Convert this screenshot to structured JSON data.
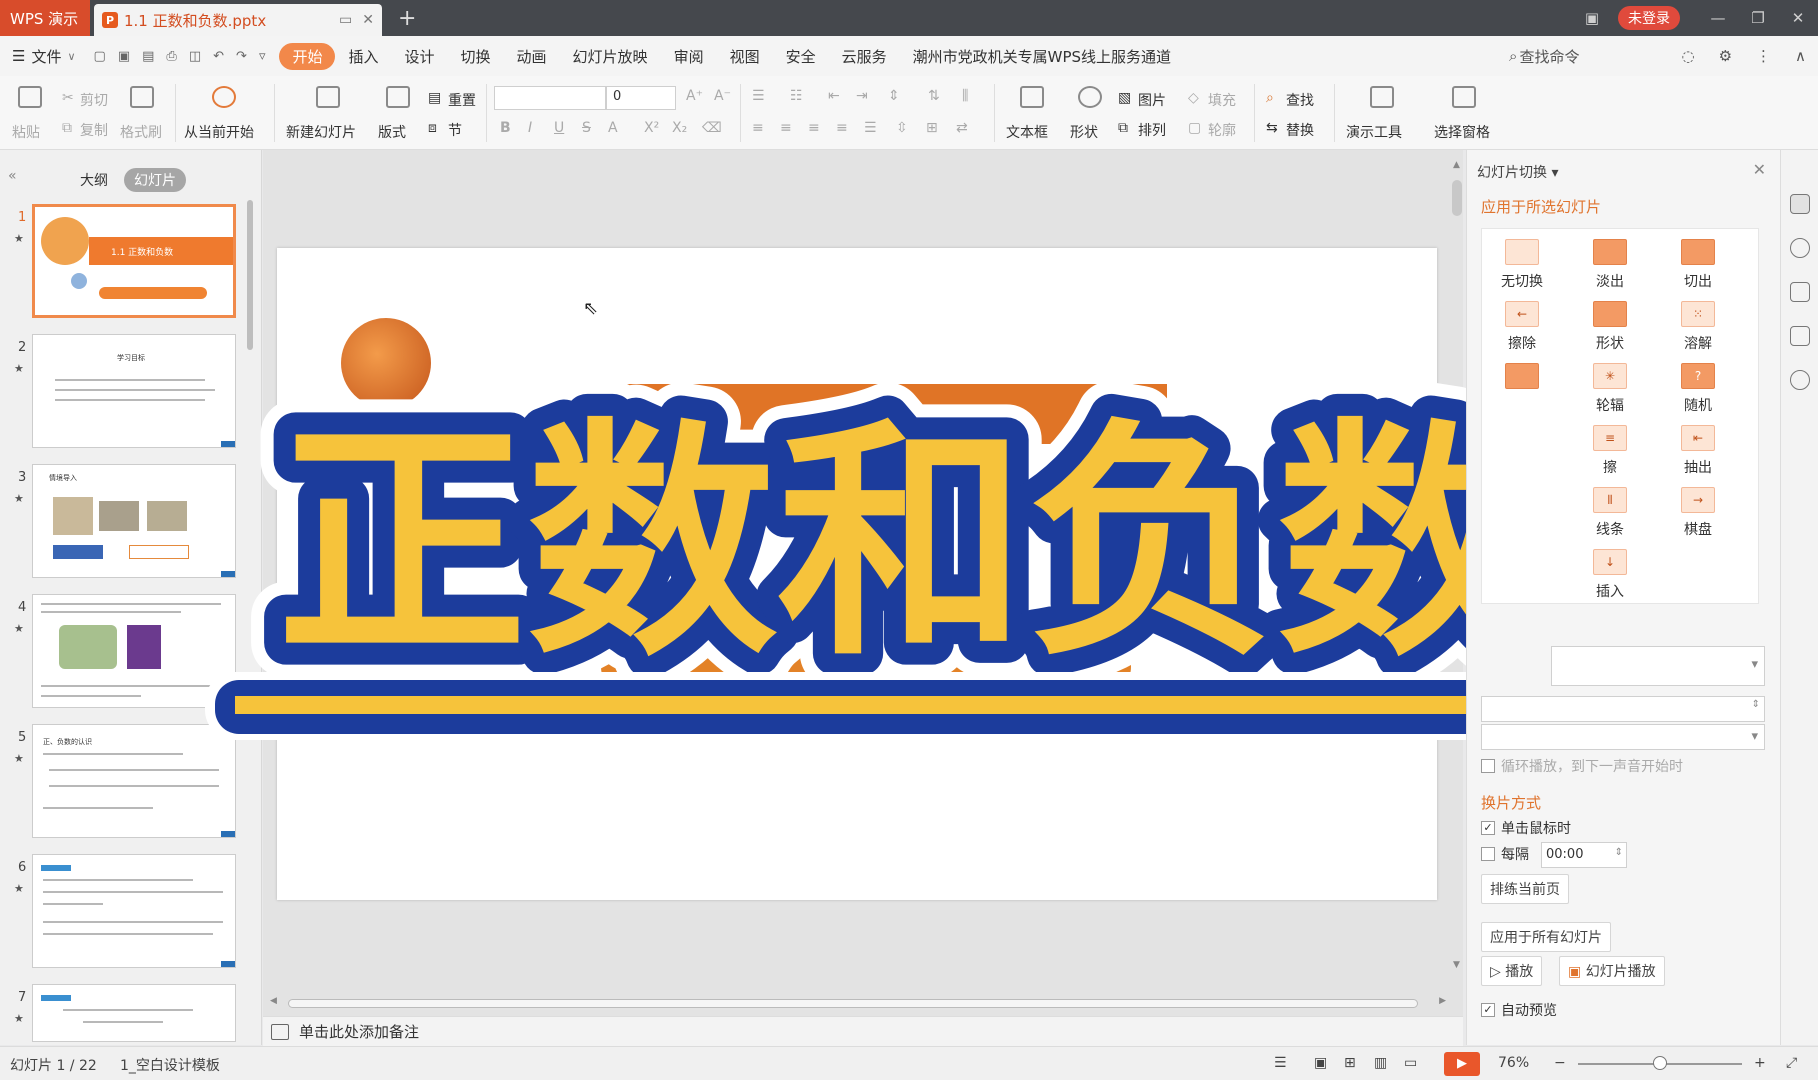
{
  "titlebar": {
    "app_name": "WPS 演示",
    "doc_tab": "1.1 正数和负数.pptx",
    "doc_icon": "P",
    "new_tab": "+",
    "login": "未登录",
    "controls": [
      "minimize-icon",
      "restore-icon",
      "close-icon"
    ]
  },
  "menubar": {
    "file": "文件",
    "items": [
      "开始",
      "插入",
      "设计",
      "切换",
      "动画",
      "幻灯片放映",
      "审阅",
      "视图",
      "安全",
      "云服务",
      "潮州市党政机关专属WPS线上服务通道"
    ],
    "active": "开始",
    "search": "查找命令"
  },
  "ribbon": {
    "paste": "粘贴",
    "cut": "剪切",
    "copy": "复制",
    "format_painter": "格式刷",
    "from_current": "从当前开始",
    "new_slide": "新建幻灯片",
    "layout": "版式",
    "reset": "重置",
    "section": "节",
    "font_size": "0",
    "font_name": "",
    "text_box": "文本框",
    "shape": "形状",
    "picture": "图片",
    "arrange": "排列",
    "fill": "填充",
    "outline": "轮廓",
    "find": "查找",
    "replace": "替换",
    "present_tools": "演示工具",
    "select_pane": "选择窗格"
  },
  "left_panel": {
    "tabs": [
      "大纲",
      "幻灯片"
    ],
    "active_tab": "幻灯片",
    "slides": [
      {
        "num": "1",
        "title": "1.1 正数和负数"
      },
      {
        "num": "2",
        "title": "学习目标"
      },
      {
        "num": "3",
        "title": "情境导入"
      },
      {
        "num": "4",
        "title": ""
      },
      {
        "num": "5",
        "title": "正、负数的认识"
      },
      {
        "num": "6",
        "title": ""
      },
      {
        "num": "7",
        "title": ""
      }
    ]
  },
  "slide_title_overlay": "正数和负数",
  "notes": "单击此处添加备注",
  "right_panel": {
    "title": "幻灯片切换",
    "apply_selected": "应用于所选幻灯片",
    "transitions": [
      "无切换",
      "淡出",
      "切出",
      "擦除",
      "形状",
      "溶解",
      "",
      "轮辐",
      "随机",
      "",
      "",
      "抽出",
      "",
      "",
      "棋盘",
      "",
      "插入",
      ""
    ],
    "visible_partials": [
      "擦",
      "线条"
    ],
    "loop_sound": "循环播放，到下一声音开始时",
    "advance_title": "换片方式",
    "on_click": "单击鼠标时",
    "every": "每隔",
    "every_time": "00:00",
    "rehearse": "排练当前页",
    "apply_all": "应用于所有幻灯片",
    "play": "播放",
    "slideshow": "幻灯片播放",
    "auto_preview": "自动预览"
  },
  "statusbar": {
    "slide_info": "幻灯片 1 / 22",
    "template": "1_空白设计模板",
    "zoom": "76%",
    "zoom_level": 0.5
  },
  "colors": {
    "accent": "#f2884a",
    "overlay_text": "#f6c33b",
    "overlay_outline": "#1c3c9c",
    "brand_red": "#d84c2b"
  }
}
